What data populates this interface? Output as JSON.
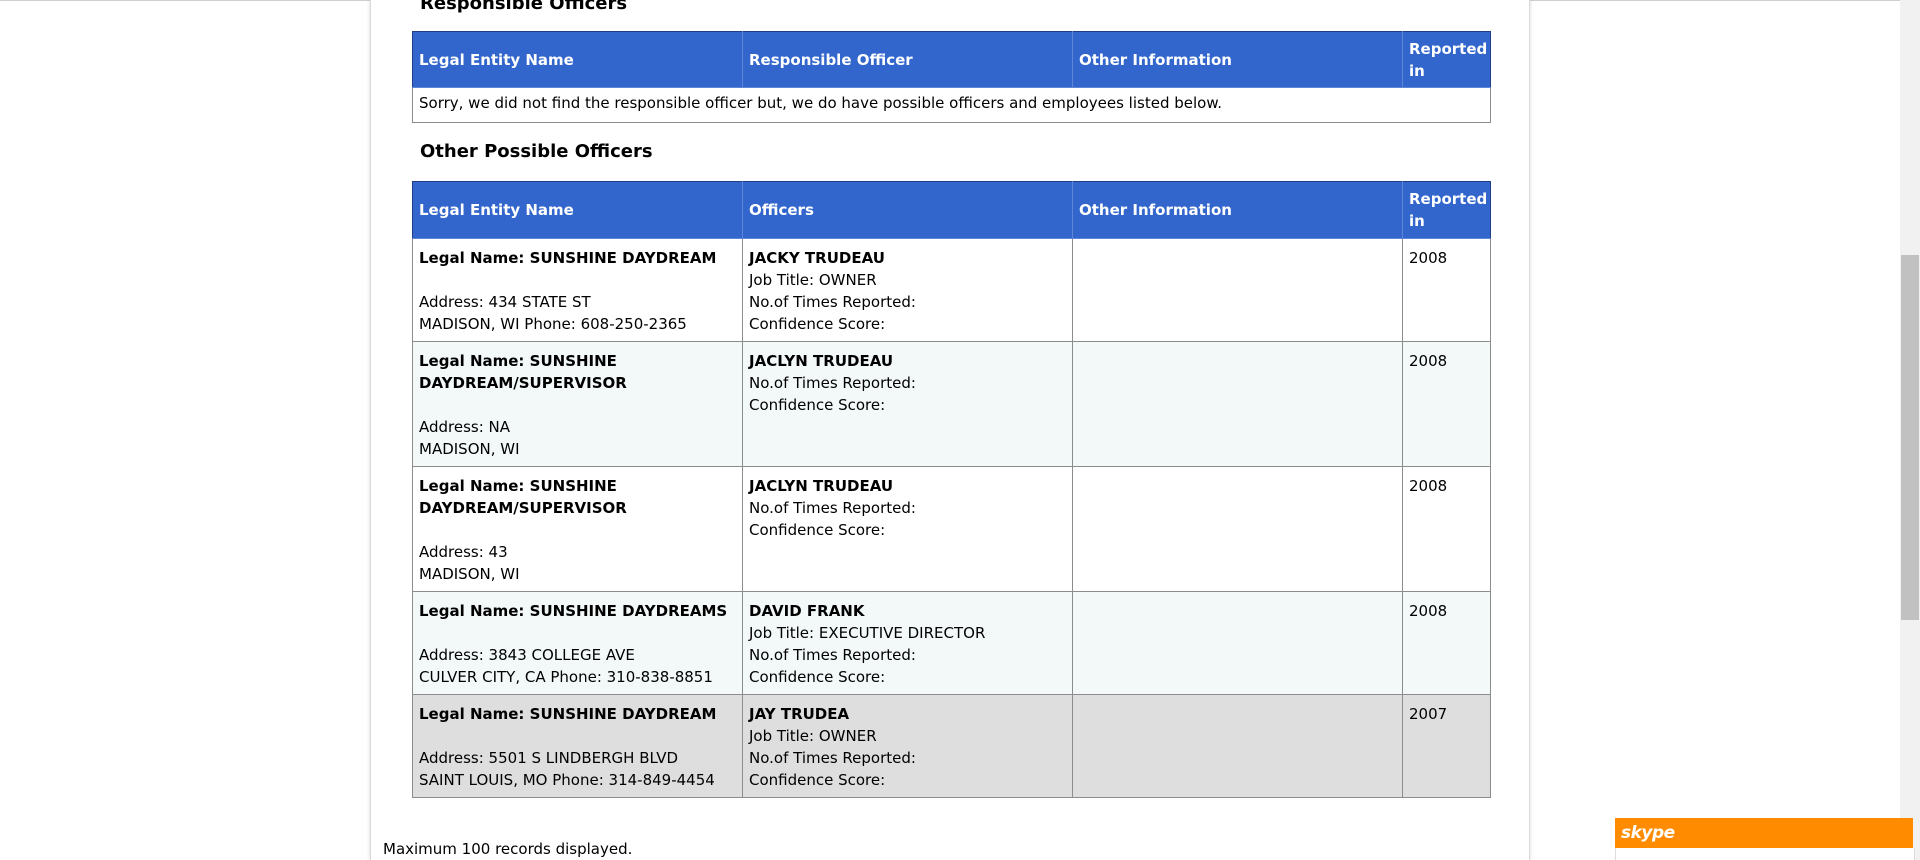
{
  "responsible": {
    "title": "Responsible Officers",
    "headers": [
      "Legal Entity Name",
      "Responsible Officer",
      "Other Information",
      "Reported in"
    ],
    "message": "Sorry, we did not find the responsible officer but, we do have possible officers and employees listed below."
  },
  "other": {
    "title": "Other Possible Officers",
    "headers": [
      "Legal Entity Name",
      "Officers",
      "Other Information",
      "Reported in"
    ],
    "rows": [
      {
        "legal_prefix": "Legal Name: ",
        "legal_name": "SUNSHINE DAYDREAM",
        "address": "Address: 434 STATE ST",
        "city": "MADISON, WI Phone: 608-250-2365",
        "officer": "JACKY TRUDEAU",
        "job_title": "Job Title: OWNER",
        "times_reported": "No.of Times Reported:",
        "confidence": "Confidence Score:",
        "other_info": "",
        "reported_in": "2008"
      },
      {
        "legal_prefix": "Legal Name: ",
        "legal_name": "SUNSHINE DAYDREAM/SUPERVISOR",
        "address": "Address: NA",
        "city": "MADISON, WI",
        "officer": "JACLYN TRUDEAU",
        "job_title": "",
        "times_reported": "No.of Times Reported:",
        "confidence": "Confidence Score:",
        "other_info": "",
        "reported_in": "2008"
      },
      {
        "legal_prefix": "Legal Name: ",
        "legal_name": "SUNSHINE DAYDREAM/SUPERVISOR",
        "address": "Address: 43",
        "city": "MADISON, WI",
        "officer": "JACLYN TRUDEAU",
        "job_title": "",
        "times_reported": "No.of Times Reported:",
        "confidence": "Confidence Score:",
        "other_info": "",
        "reported_in": "2008"
      },
      {
        "legal_prefix": "Legal Name: ",
        "legal_name": "SUNSHINE DAYDREAMS",
        "address": "Address: 3843 COLLEGE AVE",
        "city": "CULVER CITY, CA Phone: 310-838-8851",
        "officer": "DAVID FRANK",
        "job_title": "Job Title: EXECUTIVE DIRECTOR",
        "times_reported": "No.of Times Reported:",
        "confidence": "Confidence Score:",
        "other_info": "",
        "reported_in": "2008"
      },
      {
        "legal_prefix": "Legal Name: ",
        "legal_name": "SUNSHINE DAYDREAM",
        "address": "Address: 5501 S LINDBERGH BLVD",
        "city": "SAINT LOUIS, MO Phone: 314-849-4454",
        "officer": "JAY TRUDEA",
        "job_title": "Job Title: OWNER",
        "times_reported": "No.of Times Reported:",
        "confidence": "Confidence Score:",
        "other_info": "",
        "reported_in": "2007"
      }
    ]
  },
  "footer": {
    "note": "Maximum 100 records displayed."
  },
  "skype": {
    "label": "skype",
    "color": "#ff8c00"
  },
  "colors": {
    "header_bg": "#3366cc",
    "row_alt": "#f3f9f9",
    "row_highlight": "#dedede"
  }
}
